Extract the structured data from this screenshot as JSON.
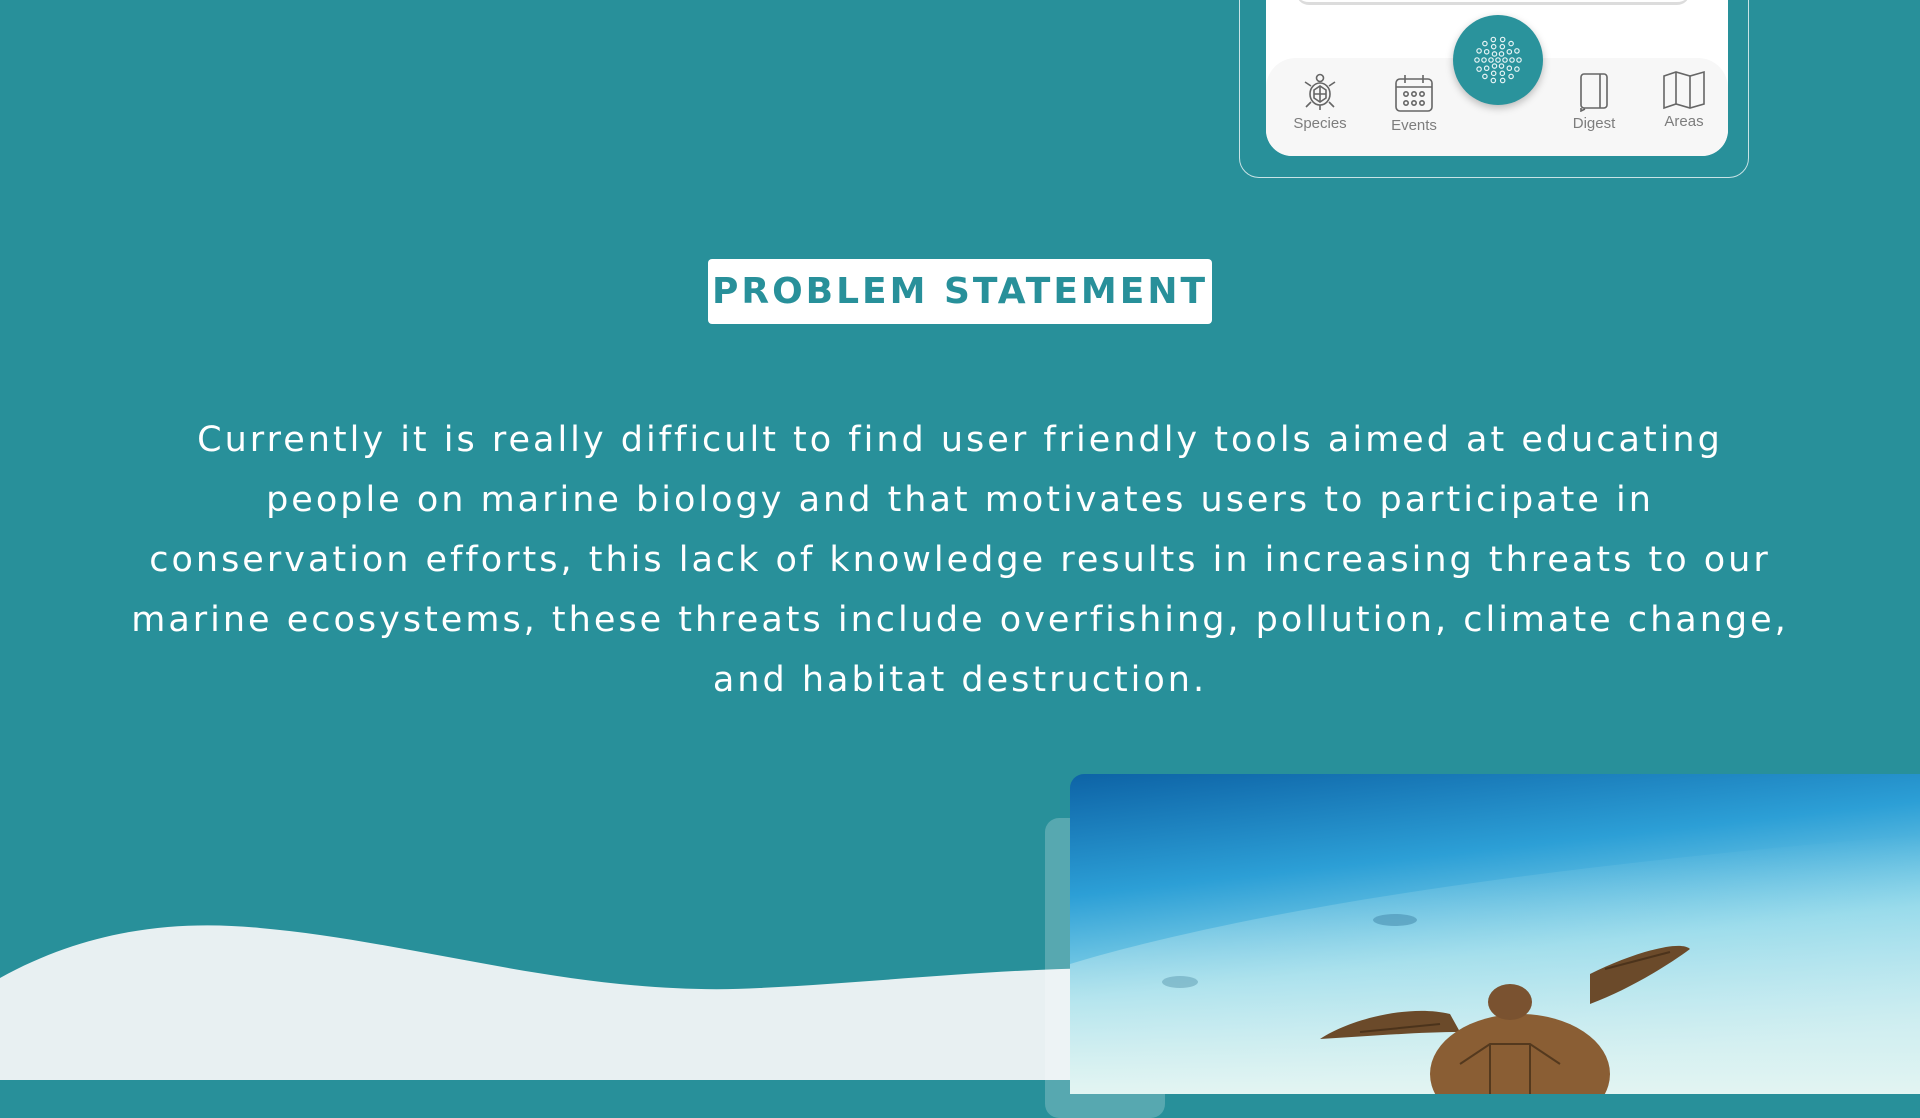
{
  "nav": {
    "items": [
      {
        "label": "Species",
        "icon": "turtle-icon"
      },
      {
        "label": "Events",
        "icon": "calendar-icon"
      },
      {
        "label": "Digest",
        "icon": "book-icon"
      },
      {
        "label": "Areas",
        "icon": "map-icon"
      }
    ],
    "center_icon": "dots-icon"
  },
  "problem": {
    "title": "PROBLEM STATEMENT",
    "body": "Currently it is really difficult to find user friendly tools aimed at educating people on marine biology and that motivates users to participate in conservation efforts, this lack of knowledge results in increasing threats to our marine ecosystems, these threats include overfishing, pollution, climate change, and habitat destruction."
  },
  "colors": {
    "background": "#28909a",
    "wave": "#e8f0f2",
    "badge_bg": "#ffffff",
    "accent": "#28909a"
  }
}
